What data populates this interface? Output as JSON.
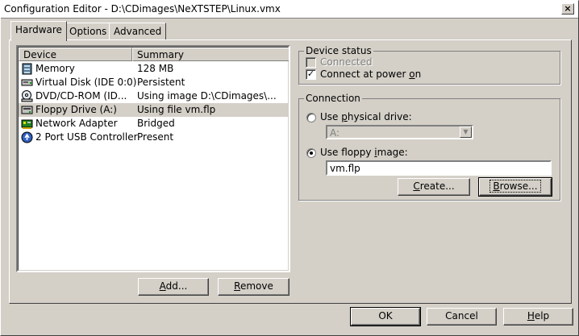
{
  "window": {
    "title": "Configuration Editor - D:\\CDimages\\NeXTSTEP\\Linux.vmx",
    "close_glyph": "×"
  },
  "tabs": [
    {
      "label": "Hardware",
      "active": true
    },
    {
      "label": "Options",
      "active": false
    },
    {
      "label": "Advanced",
      "active": false
    }
  ],
  "device_list": {
    "columns": [
      "Device",
      "Summary"
    ],
    "rows": [
      {
        "device": "Memory",
        "summary": "128 MB",
        "icon": "memory-icon",
        "selected": false
      },
      {
        "device": "Virtual Disk (IDE 0:0)",
        "summary": "Persistent",
        "icon": "hard-disk-icon",
        "selected": false
      },
      {
        "device": "DVD/CD-ROM (ID...",
        "summary": "Using image D:\\CDimages\\...",
        "icon": "cdrom-icon",
        "selected": false
      },
      {
        "device": "Floppy Drive (A:)",
        "summary": "Using file vm.flp",
        "icon": "floppy-icon",
        "selected": true
      },
      {
        "device": "Network Adapter",
        "summary": "Bridged",
        "icon": "network-adapter-icon",
        "selected": false
      },
      {
        "device": "2 Port USB Controller",
        "summary": "Present",
        "icon": "usb-icon",
        "selected": false
      }
    ]
  },
  "list_buttons": {
    "add_pre": "",
    "add_ul": "A",
    "add_post": "dd...",
    "remove_pre": "",
    "remove_ul": "R",
    "remove_post": "emove"
  },
  "device_status": {
    "title": "Device status",
    "connected": {
      "label": "Connected",
      "checked": false,
      "disabled": true
    },
    "connect_at_power_on": {
      "pre": "Connect at power ",
      "ul": "o",
      "post": "n",
      "checked": true
    }
  },
  "connection": {
    "title": "Connection",
    "use_physical": {
      "pre": "Use ",
      "ul": "p",
      "post": "hysical drive:",
      "selected": false
    },
    "physical_drive_value": "A:",
    "use_floppy_image": {
      "pre": "Use floppy ",
      "ul": "i",
      "post": "mage:",
      "selected": true
    },
    "image_path": "vm.flp",
    "create": {
      "pre": "",
      "ul": "C",
      "post": "reate..."
    },
    "browse": {
      "pre": "",
      "ul": "B",
      "post": "rowse..."
    }
  },
  "footer": {
    "ok": "OK",
    "cancel": "Cancel",
    "help": {
      "pre": "",
      "ul": "H",
      "post": "elp"
    }
  }
}
